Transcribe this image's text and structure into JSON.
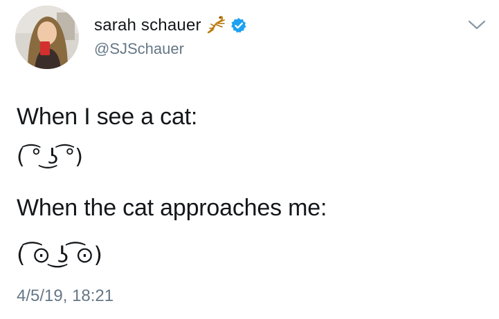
{
  "user": {
    "display_name": "sarah schauer",
    "handle": "@SJSchauer",
    "name_emoji": "scorpion-icon",
    "verified": true
  },
  "tweet": {
    "line_1": "When I see a cat:",
    "face_1": "( ͡° ͜ʖ ͡°)",
    "line_2": "When the cat approaches me:",
    "face_2": "( ͡⊙ ͜ʖ ͡⊙)",
    "timestamp": "4/5/19, 18:21"
  },
  "colors": {
    "text": "#14171a",
    "secondary": "#657786",
    "verified_blue": "#1da1f2",
    "scorpion": "#c8830b"
  },
  "icons": [
    "avatar",
    "scorpion-icon",
    "verified-badge-icon",
    "chevron-down-icon"
  ]
}
